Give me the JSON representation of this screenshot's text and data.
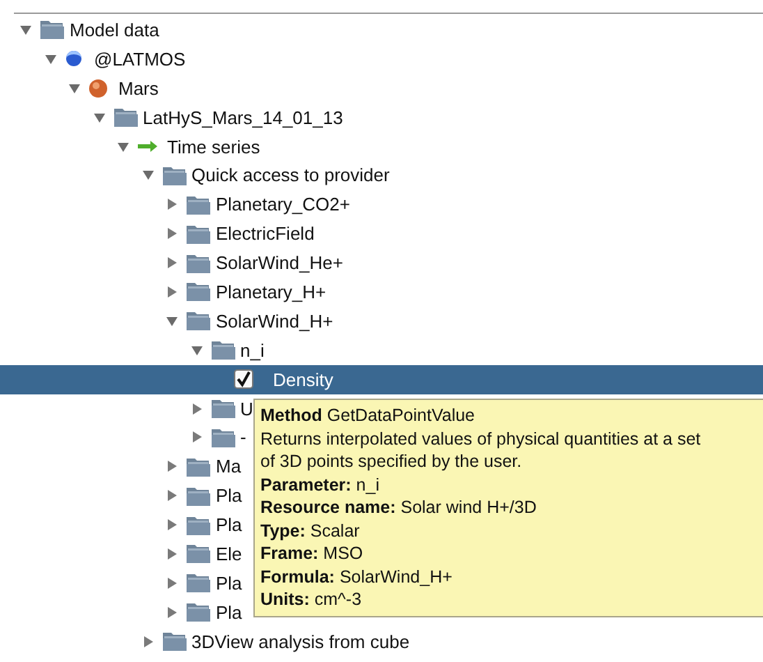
{
  "tree": [
    {
      "label": "Model data",
      "kind": "folder",
      "expanded": true,
      "selected": false,
      "children": [
        {
          "label": "@LATMOS",
          "kind": "sphere",
          "expanded": true,
          "selected": false,
          "children": [
            {
              "label": "Mars",
              "kind": "planet",
              "expanded": true,
              "selected": false,
              "children": [
                {
                  "label": "LatHyS_Mars_14_01_13",
                  "kind": "folder",
                  "expanded": true,
                  "selected": false,
                  "children": [
                    {
                      "label": "Time series",
                      "kind": "arrow",
                      "expanded": true,
                      "selected": false,
                      "children": [
                        {
                          "label": "Quick access to provider",
                          "kind": "folder",
                          "expanded": true,
                          "selected": false,
                          "children": [
                            {
                              "label": "Planetary_CO2+",
                              "kind": "folder",
                              "expanded": false,
                              "selected": false
                            },
                            {
                              "label": "ElectricField",
                              "kind": "folder",
                              "expanded": false,
                              "selected": false
                            },
                            {
                              "label": "SolarWind_He+",
                              "kind": "folder",
                              "expanded": false,
                              "selected": false
                            },
                            {
                              "label": "Planetary_H+",
                              "kind": "folder",
                              "expanded": false,
                              "selected": false
                            },
                            {
                              "label": "SolarWind_H+",
                              "kind": "folder",
                              "expanded": true,
                              "selected": false,
                              "children": [
                                {
                                  "label": "n_i",
                                  "kind": "folder",
                                  "expanded": true,
                                  "selected": false,
                                  "children": [
                                    {
                                      "label": "Density",
                                      "kind": "checkbox",
                                      "checked": true,
                                      "selected": true
                                    }
                                  ]
                                },
                                {
                                  "label": "U",
                                  "kind": "folder",
                                  "expanded": false,
                                  "selected": false
                                },
                                {
                                  "label": "-",
                                  "kind": "folder",
                                  "expanded": false,
                                  "selected": false
                                }
                              ]
                            },
                            {
                              "label": "Ma",
                              "kind": "folder",
                              "expanded": false,
                              "selected": false
                            },
                            {
                              "label": "Pla",
                              "kind": "folder",
                              "expanded": false,
                              "selected": false
                            },
                            {
                              "label": "Pla",
                              "kind": "folder",
                              "expanded": false,
                              "selected": false
                            },
                            {
                              "label": "Ele",
                              "kind": "folder",
                              "expanded": false,
                              "selected": false
                            },
                            {
                              "label": "Pla",
                              "kind": "folder",
                              "expanded": false,
                              "selected": false
                            },
                            {
                              "label": "Pla",
                              "kind": "folder",
                              "expanded": false,
                              "selected": false
                            }
                          ]
                        },
                        {
                          "label": "3DView analysis from cube",
                          "kind": "folder",
                          "expanded": false,
                          "selected": false
                        }
                      ]
                    }
                  ]
                }
              ]
            }
          ]
        }
      ]
    }
  ],
  "tooltip": {
    "lines": [
      "**Method** GetDataPointValue",
      "Returns interpolated values of physical quantities at a set",
      "of 3D points specified by the user.",
      "**Parameter:** n_i",
      "**Resource name:** Solar wind H+/3D",
      "**Type:** Scalar",
      "**Frame:** MSO",
      "**Formula:** SolarWind_H+",
      "**Units:** cm^-3"
    ]
  }
}
